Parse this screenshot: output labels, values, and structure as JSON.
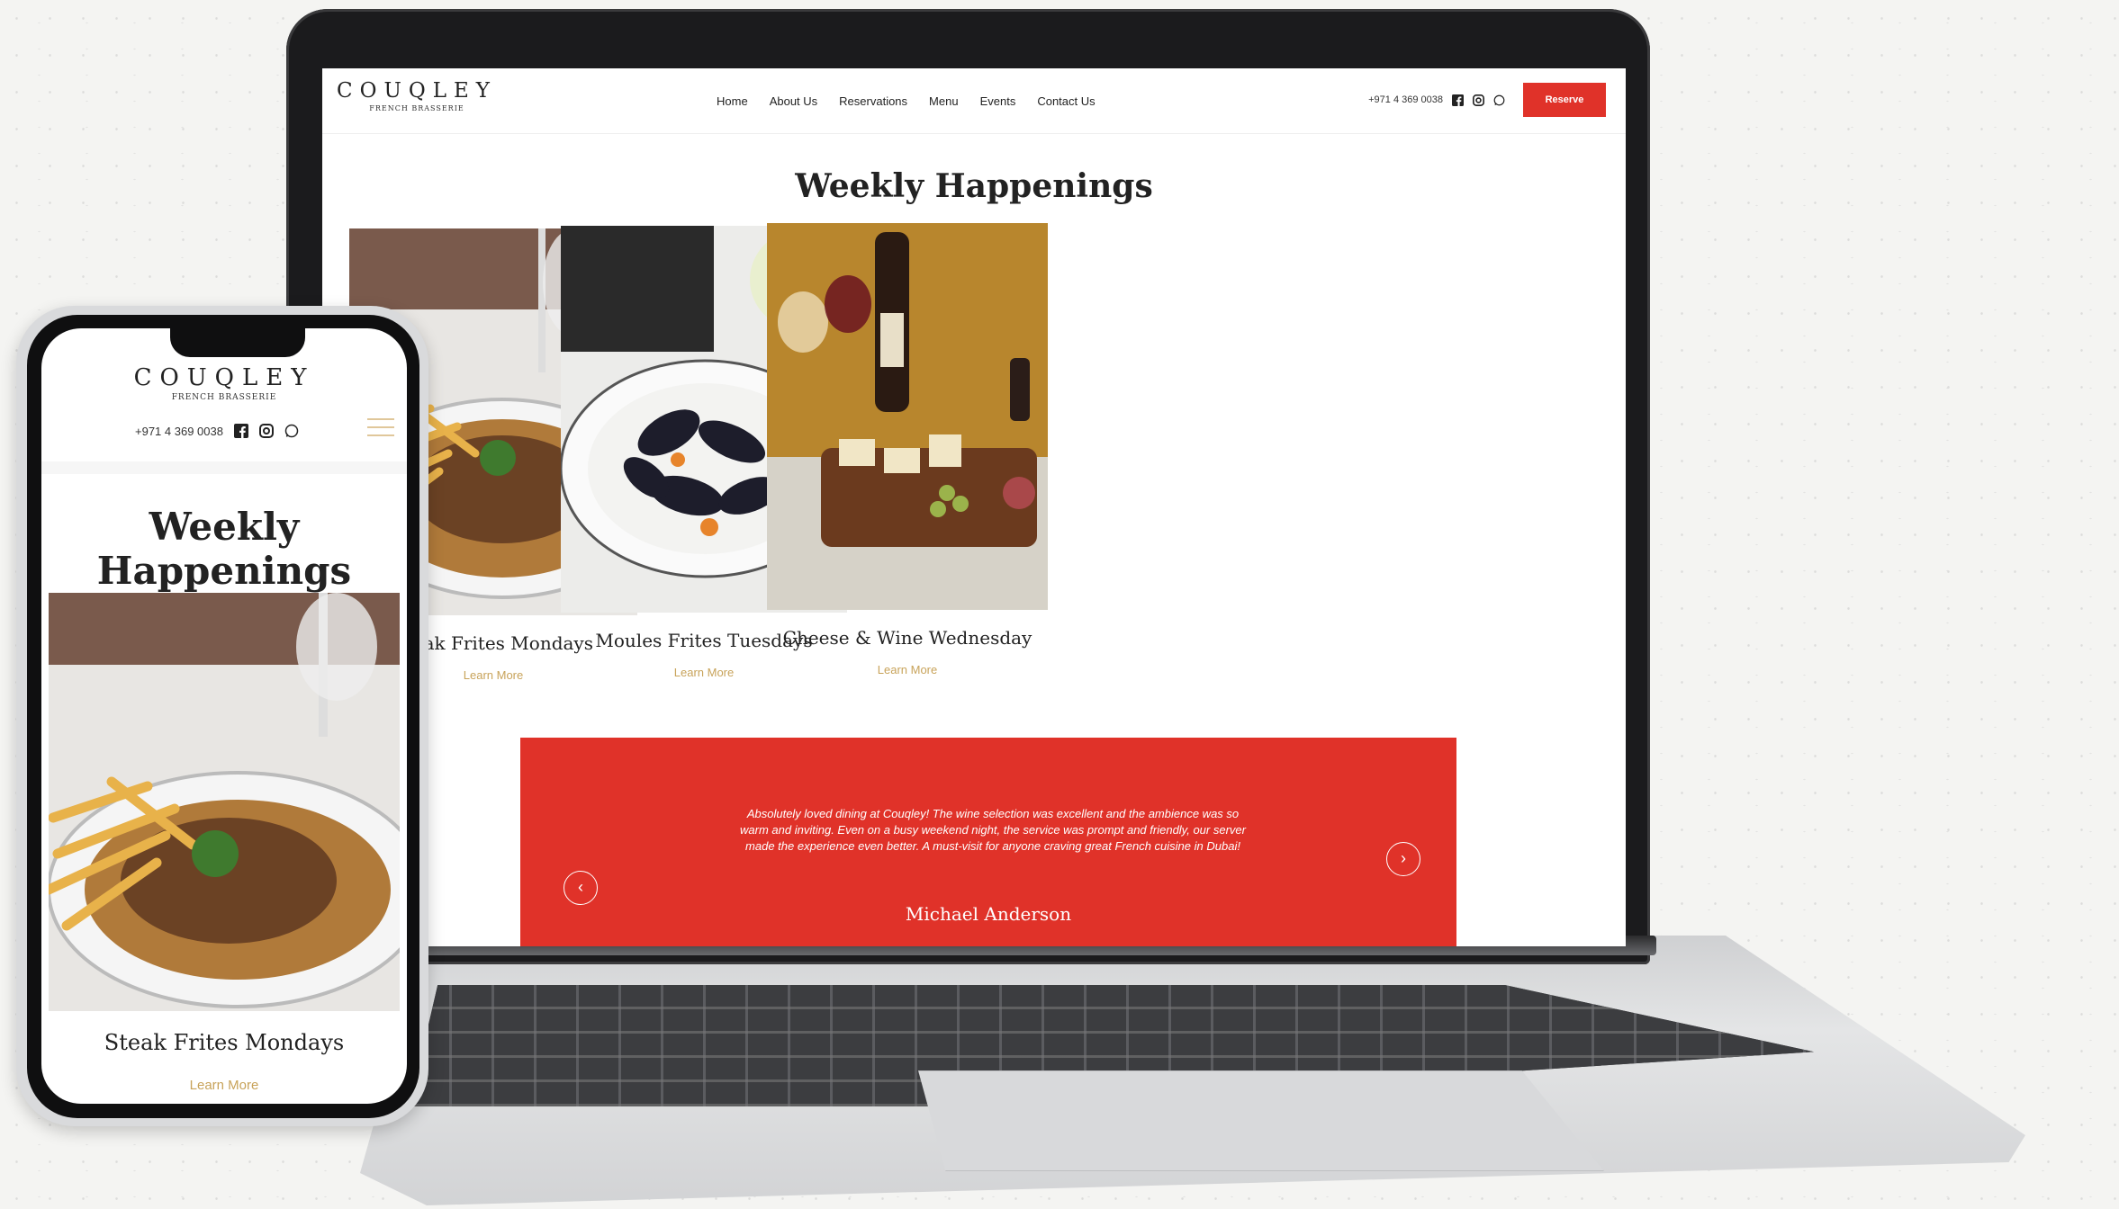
{
  "laptop": {
    "logo": {
      "name": "COUQLEY",
      "est": "",
      "sub": "FRENCH BRASSERIE"
    },
    "nav": [
      "Home",
      "About Us",
      "Reservations",
      "Menu",
      "Events",
      "Contact Us"
    ],
    "phone": "+971 4 369 0038",
    "reserve_label": "Reserve",
    "section_title": "Weekly Happenings",
    "cards": [
      {
        "name": "Steak Frites Mondays",
        "link": "Learn More"
      },
      {
        "name": "Moules Frites Tuesdays",
        "link": "Learn More"
      },
      {
        "name": "Cheese & Wine Wednesday",
        "link": "Learn More"
      }
    ],
    "testimonial": {
      "quote": "Absolutely loved dining at Couqley! The wine selection was excellent and the ambience was so warm and inviting. Even on a busy weekend night, the service was prompt and friendly, our server made the experience even better. A must-visit for anyone craving great French cuisine in Dubai!",
      "author": "Michael Anderson",
      "prev_icon": "‹",
      "next_icon": "›"
    },
    "colors": {
      "accent": "#e03229",
      "gold": "#c8a35a"
    }
  },
  "mobile": {
    "logo": {
      "name": "COUQLEY",
      "sub": "FRENCH BRASSERIE"
    },
    "phone": "+971 4 369 0038",
    "section_title": "Weekly Happenings",
    "card": {
      "name": "Steak Frites Mondays",
      "link": "Learn More"
    }
  },
  "icons": [
    "facebook-icon",
    "instagram-icon",
    "whatsapp-icon",
    "menu-icon",
    "chevron-left-icon",
    "chevron-right-icon"
  ]
}
